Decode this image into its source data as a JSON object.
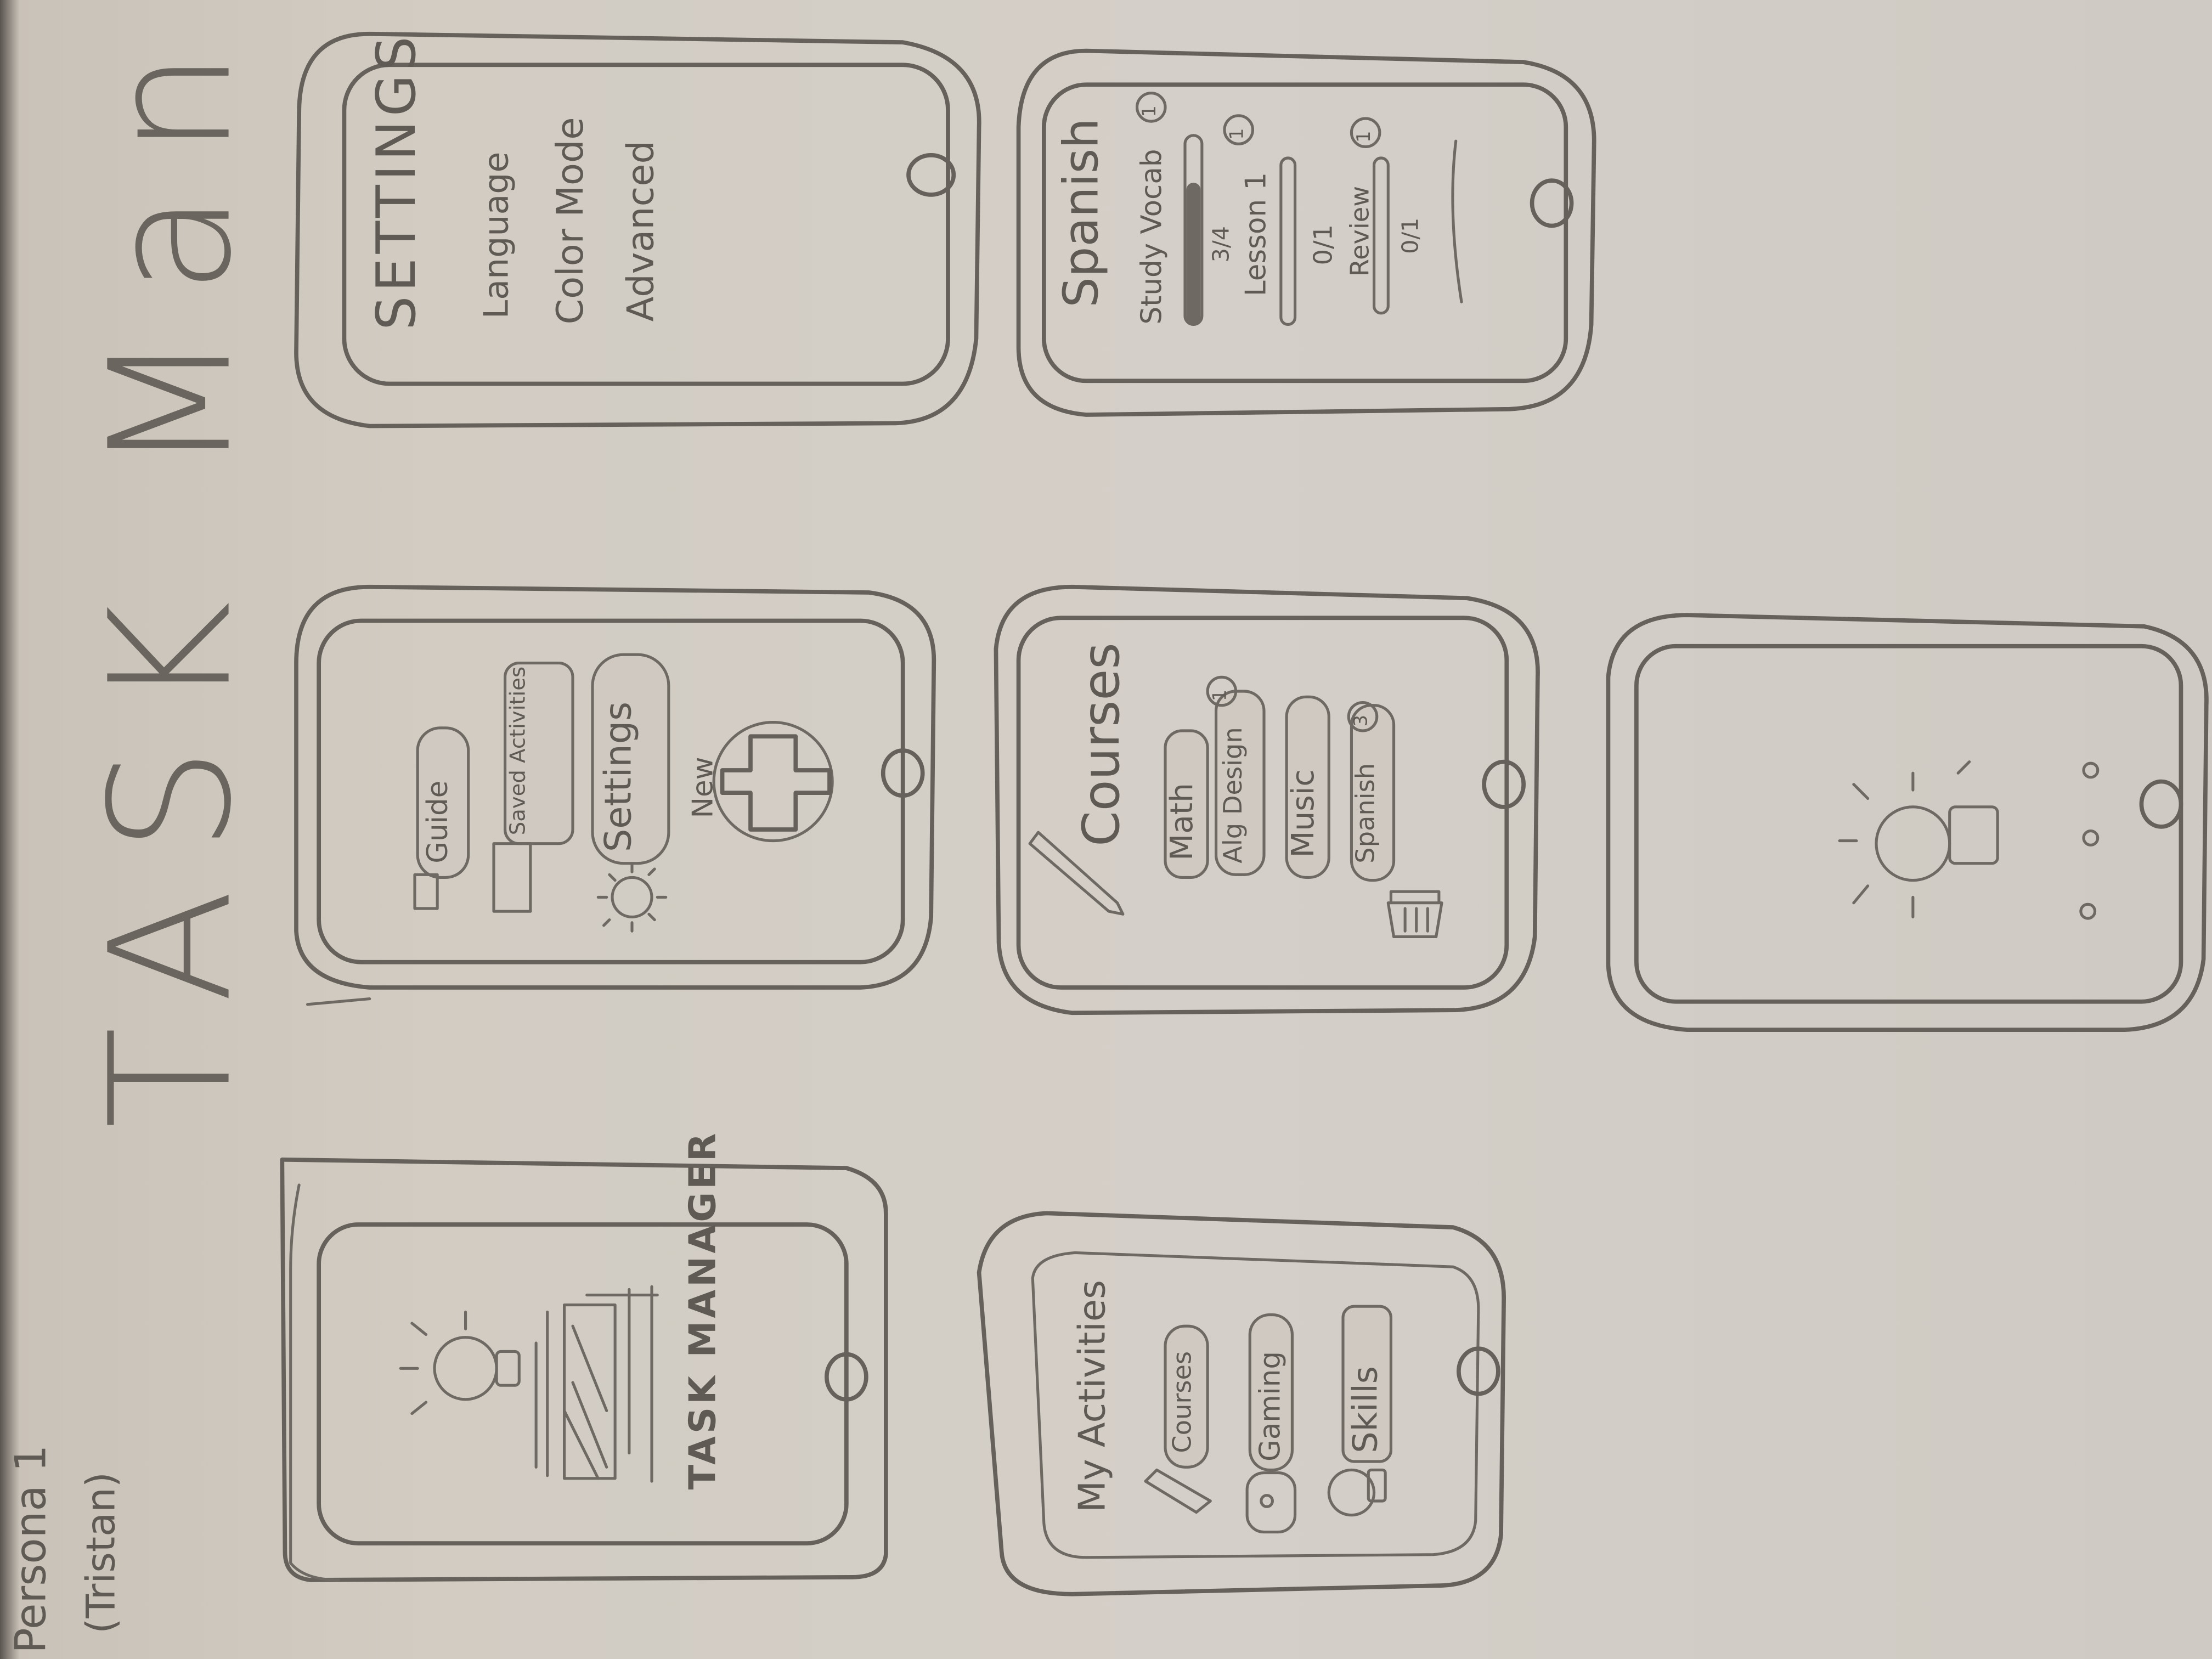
{
  "page": {
    "persona": "Persona 1",
    "persona_name": "(Tristan)",
    "title": "TASK Manager"
  },
  "splash": {
    "brand": "TASK MANAGER"
  },
  "menu": {
    "items": [
      {
        "label": "Guide"
      },
      {
        "label": "Saved Activities"
      },
      {
        "label": "Settings"
      }
    ],
    "new_label": "New"
  },
  "settings": {
    "title": "SETTINGS",
    "items": [
      "Language",
      "Color Mode",
      "Advanced"
    ]
  },
  "activities": {
    "title": "My Activities",
    "items": [
      {
        "label": "Courses",
        "icon": "pencil-icon"
      },
      {
        "label": "Gaming",
        "icon": "gamepad-icon"
      },
      {
        "label": "Skills",
        "icon": "lightbulb-icon"
      }
    ]
  },
  "courses": {
    "title": "Courses",
    "items": [
      {
        "label": "Math",
        "badge": ""
      },
      {
        "label": "Alg Design",
        "badge": "1"
      },
      {
        "label": "Music",
        "badge": ""
      },
      {
        "label": "Spanish",
        "badge": "3"
      }
    ]
  },
  "spanish": {
    "title": "Spanish",
    "tasks": [
      {
        "label": "Study Vocab",
        "badge": "1",
        "progress_text": "3/4",
        "progress": 0.75
      },
      {
        "label": "Lesson 1",
        "badge": "1",
        "progress_text": "0/1",
        "progress": 0
      },
      {
        "label": "Review",
        "badge": "1",
        "progress_text": "0/1",
        "progress": 0
      }
    ]
  },
  "loading": {
    "dots": 3
  }
}
